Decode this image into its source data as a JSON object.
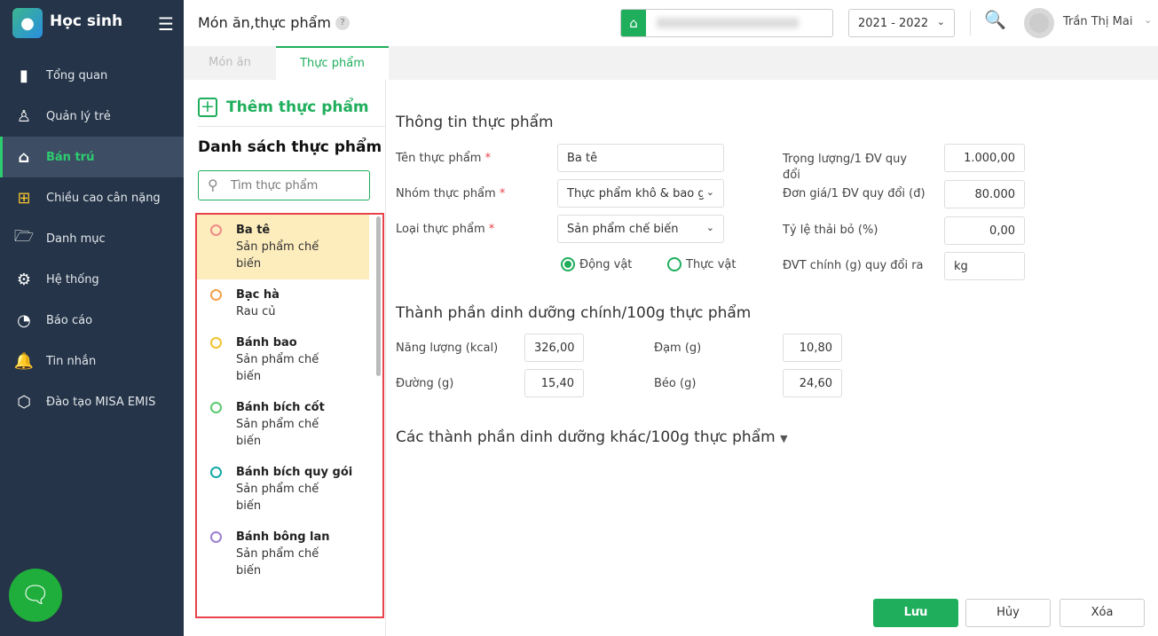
{
  "app": {
    "title": "Học sinh"
  },
  "sidebar": {
    "items": [
      {
        "label": "Tổng quan",
        "icon": "chart-bars-icon"
      },
      {
        "label": "Quản lý trẻ",
        "icon": "person-icon"
      },
      {
        "label": "Bán trú",
        "icon": "house-icon",
        "active": true
      },
      {
        "label": "Chiều cao cân nặng",
        "icon": "medkit-icon"
      },
      {
        "label": "Danh mục",
        "icon": "folder-icon"
      },
      {
        "label": "Hệ thống",
        "icon": "gear-icon"
      },
      {
        "label": "Báo cáo",
        "icon": "pie-chart-icon"
      },
      {
        "label": "Tin nhắn",
        "icon": "bell-icon"
      },
      {
        "label": "Đào tạo MISA EMIS",
        "icon": "cube-icon"
      }
    ]
  },
  "header": {
    "title": "Món ăn,thực phẩm",
    "help": "?",
    "year": "2021 - 2022",
    "user": "Trần Thị Mai"
  },
  "tabs": [
    {
      "label": "Món ăn"
    },
    {
      "label": "Thực phẩm",
      "active": true
    }
  ],
  "left": {
    "add_label": "Thêm thực phẩm",
    "list_title": "Danh sách thực phẩm",
    "search_placeholder": "Tìm thực phẩm",
    "items": [
      {
        "name": "Ba tê",
        "type": "Sản phẩm chế biến",
        "color": "#f08a8a"
      },
      {
        "name": "Bạc hà",
        "type": "Rau củ",
        "color": "#f5a04a"
      },
      {
        "name": "Bánh bao",
        "type": "Sản phẩm chế biến",
        "color": "#f2c230"
      },
      {
        "name": "Bánh bích cốt",
        "type": "Sản phẩm chế biến",
        "color": "#5cc96e"
      },
      {
        "name": "Bánh bích quy gói",
        "type": "Sản phẩm chế biến",
        "color": "#15a8a8"
      },
      {
        "name": "Bánh bông lan",
        "type": "Sản phẩm chế biến",
        "color": "#9b7fd1"
      }
    ]
  },
  "form": {
    "section1": "Thông tin thực phẩm",
    "name_label": "Tên thực phẩm",
    "name_value": "Ba tê",
    "group_label": "Nhóm thực phẩm",
    "group_value": "Thực phẩm khô & bao g",
    "type_label": "Loại thực phẩm",
    "type_value": "Sản phẩm chế biến",
    "radio_animal": "Động vật",
    "radio_plant": "Thực vật",
    "weight_label": "Trọng lượng/1 ĐV quy đổi",
    "weight_value": "1.000,00",
    "price_label": "Đơn giá/1 ĐV quy đổi (đ)",
    "price_value": "80.000",
    "waste_label": "Tỷ lệ thải bỏ (%)",
    "waste_value": "0,00",
    "unit_label": "ĐVT chính (g) quy đổi ra",
    "unit_value": "kg",
    "required": "*",
    "section2": "Thành phần dinh dưỡng chính/100g thực phẩm",
    "energy_label": "Năng lượng (kcal)",
    "energy_value": "326,00",
    "protein_label": "Đạm (g)",
    "protein_value": "10,80",
    "sugar_label": "Đường (g)",
    "sugar_value": "15,40",
    "fat_label": "Béo (g)",
    "fat_value": "24,60",
    "section3": "Các thành phần dinh dưỡng khác/100g thực phẩm"
  },
  "buttons": {
    "save": "Lưu",
    "cancel": "Hủy",
    "delete": "Xóa"
  }
}
